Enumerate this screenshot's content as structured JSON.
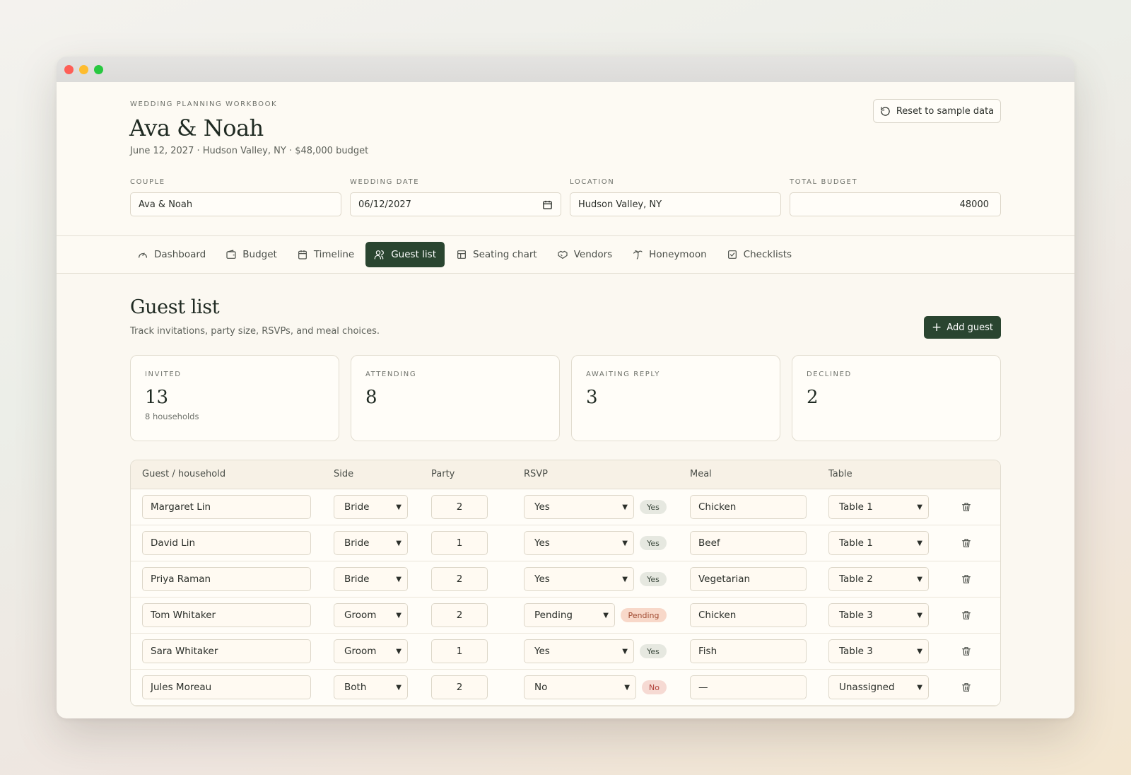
{
  "header": {
    "eyebrow": "WEDDING PLANNING WORKBOOK",
    "title": "Ava & Noah",
    "subtitle": "June 12, 2027 · Hudson Valley, NY · $48,000 budget",
    "reset_label": "Reset to sample data"
  },
  "fields": {
    "couple_label": "COUPLE",
    "couple_value": "Ava & Noah",
    "date_label": "WEDDING DATE",
    "date_value": "06/12/2027",
    "location_label": "LOCATION",
    "location_value": "Hudson Valley, NY",
    "budget_label": "TOTAL BUDGET",
    "budget_value": "48000"
  },
  "tabs": [
    {
      "label": "Dashboard",
      "icon": "gauge-icon"
    },
    {
      "label": "Budget",
      "icon": "wallet-icon"
    },
    {
      "label": "Timeline",
      "icon": "calendar-icon"
    },
    {
      "label": "Guest list",
      "icon": "users-icon"
    },
    {
      "label": "Seating chart",
      "icon": "table-layout-icon"
    },
    {
      "label": "Vendors",
      "icon": "handshake-icon"
    },
    {
      "label": "Honeymoon",
      "icon": "palm-tree-icon"
    },
    {
      "label": "Checklists",
      "icon": "checkbox-icon"
    }
  ],
  "active_tab": "Guest list",
  "page": {
    "title": "Guest list",
    "description": "Track invitations, party size, RSVPs, and meal choices.",
    "add_label": "Add guest"
  },
  "stats": [
    {
      "label": "INVITED",
      "value": "13",
      "note": "8 households"
    },
    {
      "label": "ATTENDING",
      "value": "8",
      "note": ""
    },
    {
      "label": "AWAITING REPLY",
      "value": "3",
      "note": ""
    },
    {
      "label": "DECLINED",
      "value": "2",
      "note": ""
    }
  ],
  "table": {
    "headers": {
      "guest": "Guest / household",
      "side": "Side",
      "party": "Party",
      "rsvp": "RSVP",
      "meal": "Meal",
      "table": "Table"
    },
    "rows": [
      {
        "name": "Margaret Lin",
        "side": "Bride",
        "party": "2",
        "rsvp": "Yes",
        "badge": "Yes",
        "meal": "Chicken",
        "table": "Table 1"
      },
      {
        "name": "David Lin",
        "side": "Bride",
        "party": "1",
        "rsvp": "Yes",
        "badge": "Yes",
        "meal": "Beef",
        "table": "Table 1"
      },
      {
        "name": "Priya Raman",
        "side": "Bride",
        "party": "2",
        "rsvp": "Yes",
        "badge": "Yes",
        "meal": "Vegetarian",
        "table": "Table 2"
      },
      {
        "name": "Tom Whitaker",
        "side": "Groom",
        "party": "2",
        "rsvp": "Pending",
        "badge": "Pending",
        "meal": "Chicken",
        "table": "Table 3"
      },
      {
        "name": "Sara Whitaker",
        "side": "Groom",
        "party": "1",
        "rsvp": "Yes",
        "badge": "Yes",
        "meal": "Fish",
        "table": "Table 3"
      },
      {
        "name": "Jules Moreau",
        "side": "Both",
        "party": "2",
        "rsvp": "No",
        "badge": "No",
        "meal": "—",
        "table": "Unassigned"
      }
    ]
  },
  "colors": {
    "accent": "#2a4530",
    "background": "#fbf8f1",
    "badge_yes": "#e6e8e0",
    "badge_pending": "#f8d8c9",
    "badge_no": "#f6dad3"
  }
}
